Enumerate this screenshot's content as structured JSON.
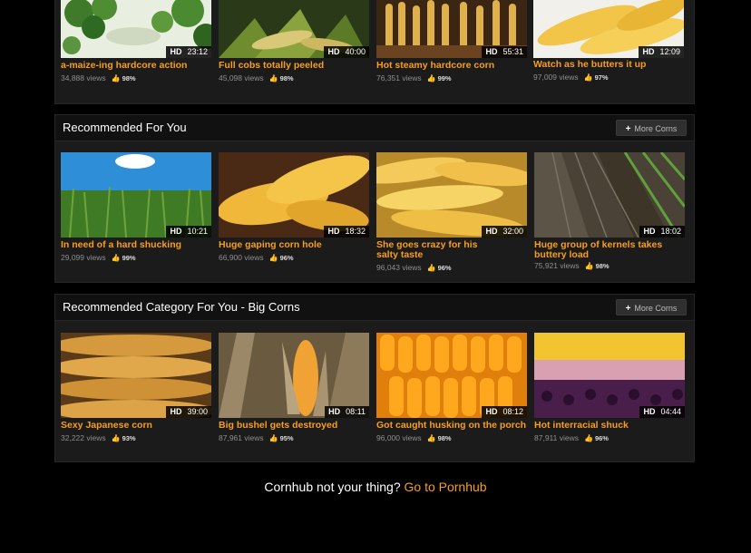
{
  "top_row": [
    {
      "title": "a-maize-ing hardcore action",
      "views": "34,888 views",
      "rating": "98%",
      "hd": "HD",
      "duration": "23:12",
      "thumb": "broccoli-greens"
    },
    {
      "title": "Full cobs totally peeled",
      "views": "45,098 views",
      "rating": "98%",
      "hd": "HD",
      "duration": "40:00",
      "thumb": "corn-husks-green"
    },
    {
      "title": "Hot steamy hardcore corn",
      "views": "76,351 views",
      "rating": "99%",
      "hd": "HD",
      "duration": "55:31",
      "thumb": "corn-crate"
    },
    {
      "title": "Watch as he butters it up",
      "views": "97,009 views",
      "rating": "97%",
      "hd": "HD",
      "duration": "12:09",
      "thumb": "corn-cobs-yellow"
    }
  ],
  "recommended": {
    "title": "Recommended For You",
    "more_label": "More Corns",
    "items": [
      {
        "title": "In need of a hard shucking",
        "views": "29,099 views",
        "rating": "99%",
        "hd": "HD",
        "duration": "10:21",
        "thumb": "cornfield-sky"
      },
      {
        "title": "Huge gaping corn hole",
        "views": "66,900 views",
        "rating": "96%",
        "hd": "HD",
        "duration": "18:32",
        "thumb": "corn-closeup"
      },
      {
        "title": "She goes crazy for his salty taste",
        "views": "96,043 views",
        "rating": "96%",
        "hd": "HD",
        "duration": "32:00",
        "thumb": "corn-pile"
      },
      {
        "title": "Huge group of kernels takes buttery load",
        "views": "75,921 views",
        "rating": "98%",
        "hd": "HD",
        "duration": "18:02",
        "thumb": "field-rows"
      }
    ]
  },
  "category": {
    "title": "Recommended Category For You - Big Corns",
    "more_label": "More Corns",
    "items": [
      {
        "title": "Sexy Japanese corn",
        "views": "32,222 views",
        "rating": "93%",
        "hd": "HD",
        "duration": "39:00",
        "thumb": "dried-corn"
      },
      {
        "title": "Big bushel gets destroyed",
        "views": "87,961 views",
        "rating": "95%",
        "hd": "HD",
        "duration": "08:11",
        "thumb": "dried-stalk"
      },
      {
        "title": "Got caught husking on the porch",
        "views": "96,000 views",
        "rating": "98%",
        "hd": "HD",
        "duration": "08:12",
        "thumb": "orange-kernels"
      },
      {
        "title": "Hot interracial shuck",
        "views": "87,911 views",
        "rating": "96%",
        "hd": "HD",
        "duration": "04:44",
        "thumb": "multicolor-corn"
      }
    ]
  },
  "footer": {
    "text": "Cornhub not your thing?",
    "link": "Go to Pornhub"
  },
  "colors": {
    "accent": "#f89e1c",
    "thumb_up": "#52a43c",
    "panel": "#1b1b1b"
  }
}
